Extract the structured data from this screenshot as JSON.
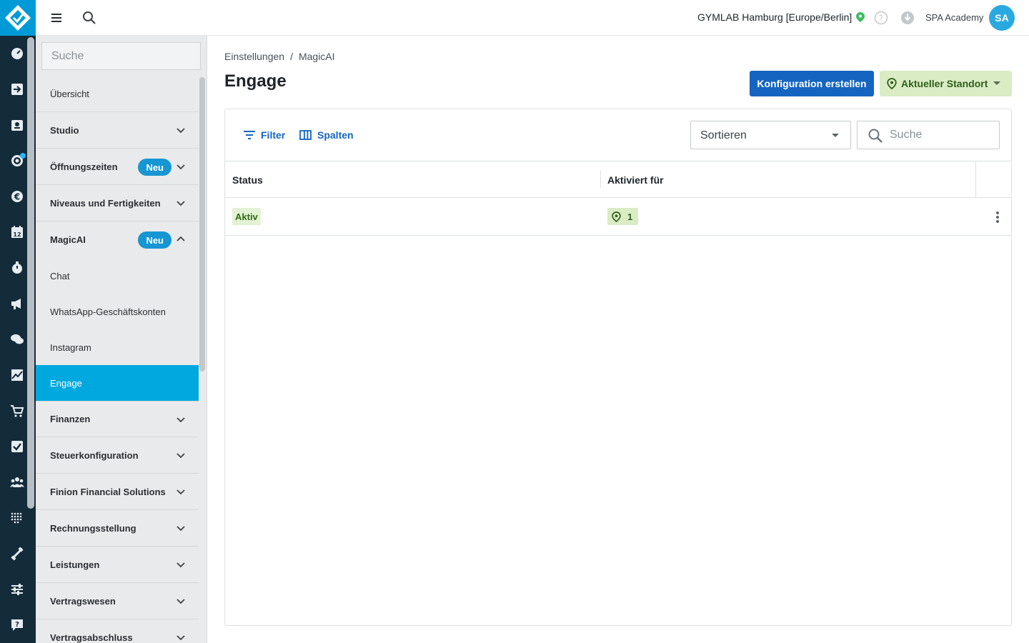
{
  "rail": {
    "icons": [
      "dashboard-icon",
      "checkin-icon",
      "contacts-icon",
      "leads-icon",
      "finance-euro-icon",
      "calendar-icon",
      "timer-icon",
      "marketing-megaphone-icon",
      "chat-icon",
      "analytics-icon",
      "shop-cart-icon",
      "tasks-check-icon",
      "groups-icon",
      "devices-icon",
      "equipment-icon",
      "settings-sliders-icon",
      "help-chat-icon"
    ],
    "calendar_day": "12"
  },
  "topbar": {
    "location": "GYMLAB Hamburg [Europe/Berlin]",
    "user": "SPA Academy",
    "avatar_initials": "SA"
  },
  "sidebar": {
    "search_placeholder": "Suche",
    "items": [
      {
        "label": "Übersicht"
      },
      {
        "label": "Studio"
      },
      {
        "label": "Öffnungszeiten",
        "badge": "Neu"
      },
      {
        "label": "Niveaus und Fertigkeiten"
      },
      {
        "label": "MagicAI",
        "badge": "Neu"
      },
      {
        "label": "Chat"
      },
      {
        "label": "WhatsApp-Geschäftskonten"
      },
      {
        "label": "Instagram"
      },
      {
        "label": "Engage"
      },
      {
        "label": "Finanzen"
      },
      {
        "label": "Steuerkonfiguration"
      },
      {
        "label": "Finion Financial Solutions"
      },
      {
        "label": "Rechnungsstellung"
      },
      {
        "label": "Leistungen"
      },
      {
        "label": "Vertragswesen"
      },
      {
        "label": "Vertragsabschluss"
      }
    ]
  },
  "main": {
    "breadcrumb": {
      "first": "Einstellungen",
      "separator": "/",
      "second": "MagicAI"
    },
    "title": "Engage",
    "create_button": "Konfiguration erstellen",
    "location_button": "Aktueller Standort",
    "toolbar": {
      "filter": "Filter",
      "columns": "Spalten",
      "sort_placeholder": "Sortieren",
      "search_placeholder": "Suche"
    },
    "table": {
      "headers": [
        "Status",
        "Aktiviert für"
      ],
      "rows": [
        {
          "status": "Aktiv",
          "activated_for": "1"
        }
      ]
    }
  }
}
